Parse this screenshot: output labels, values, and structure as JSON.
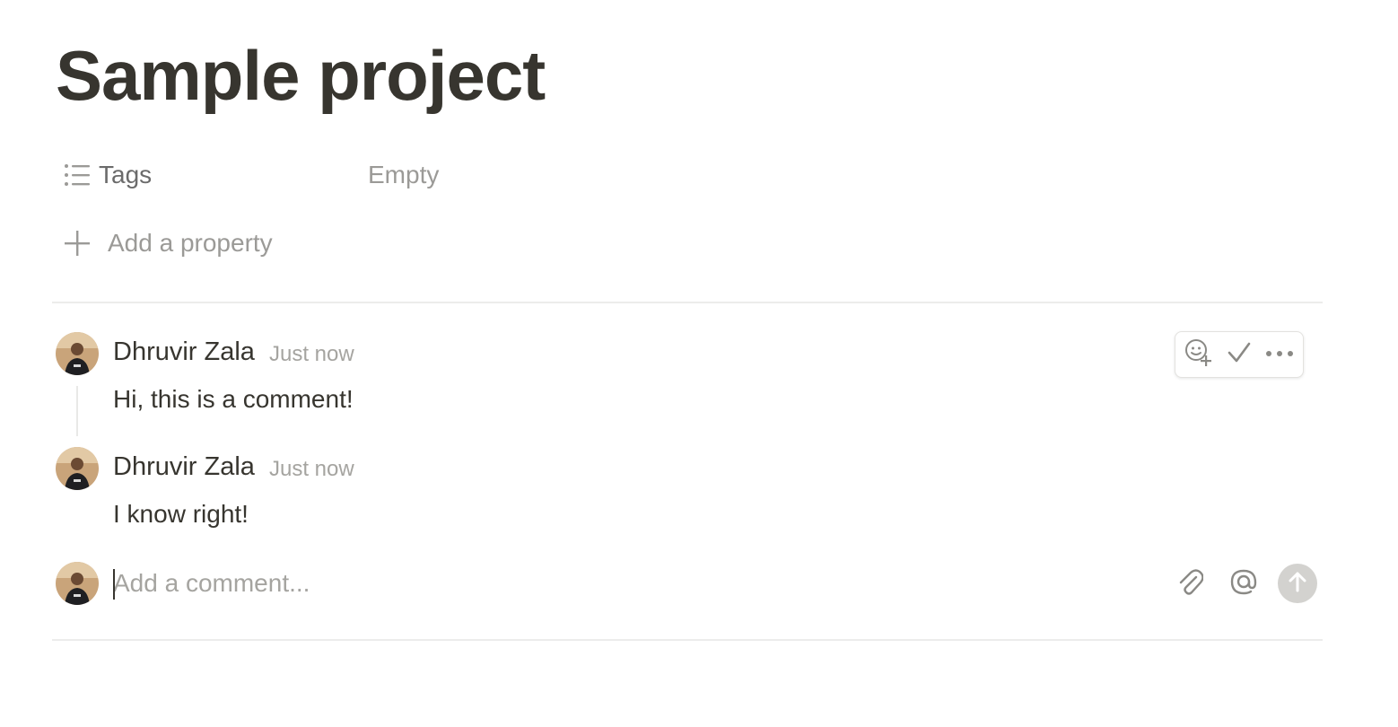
{
  "page": {
    "title": "Sample project"
  },
  "properties": {
    "tags": {
      "icon": "list-icon",
      "label": "Tags",
      "value": "Empty"
    },
    "add": {
      "icon": "plus-icon",
      "label": "Add a property"
    }
  },
  "comments": [
    {
      "author": "Dhruvir Zala",
      "time": "Just now",
      "text": "Hi, this is a comment!"
    },
    {
      "author": "Dhruvir Zala",
      "time": "Just now",
      "text": "I know right!"
    }
  ],
  "comment_actions": [
    {
      "icon": "add-reaction-icon"
    },
    {
      "icon": "resolve-check-icon"
    },
    {
      "icon": "more-icon"
    }
  ],
  "composer": {
    "placeholder": "Add a comment...",
    "icons": [
      "attachment-icon",
      "mention-icon",
      "send-icon"
    ]
  },
  "colors": {
    "text": "#37352f",
    "muted": "#9b9a97",
    "divider": "#ececeb",
    "send_button": "#d3d2cf"
  }
}
